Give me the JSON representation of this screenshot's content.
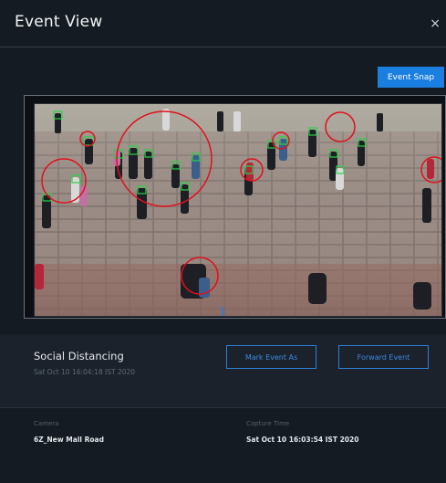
{
  "modal": {
    "title": "Event View",
    "close_symbol": "×"
  },
  "toolbar": {
    "event_snap_label": "Event Snap"
  },
  "event": {
    "type": "Social Distancing",
    "timestamp": "Sat Oct 10 16:04:18 IST 2020",
    "mark_event_label": "Mark Event As",
    "forward_event_label": "Forward Event"
  },
  "details": {
    "camera_label": "Camera",
    "camera_value": "6Z_New Mall Road",
    "capture_label": "Capture Time",
    "capture_value": "Sat Oct 10 16:03:54 IST 2020"
  },
  "colors": {
    "accent": "#1a7fe0",
    "violation_circle": "#e0101e",
    "person_box": "#2ad14a"
  },
  "icons": {
    "close": "close-icon"
  }
}
